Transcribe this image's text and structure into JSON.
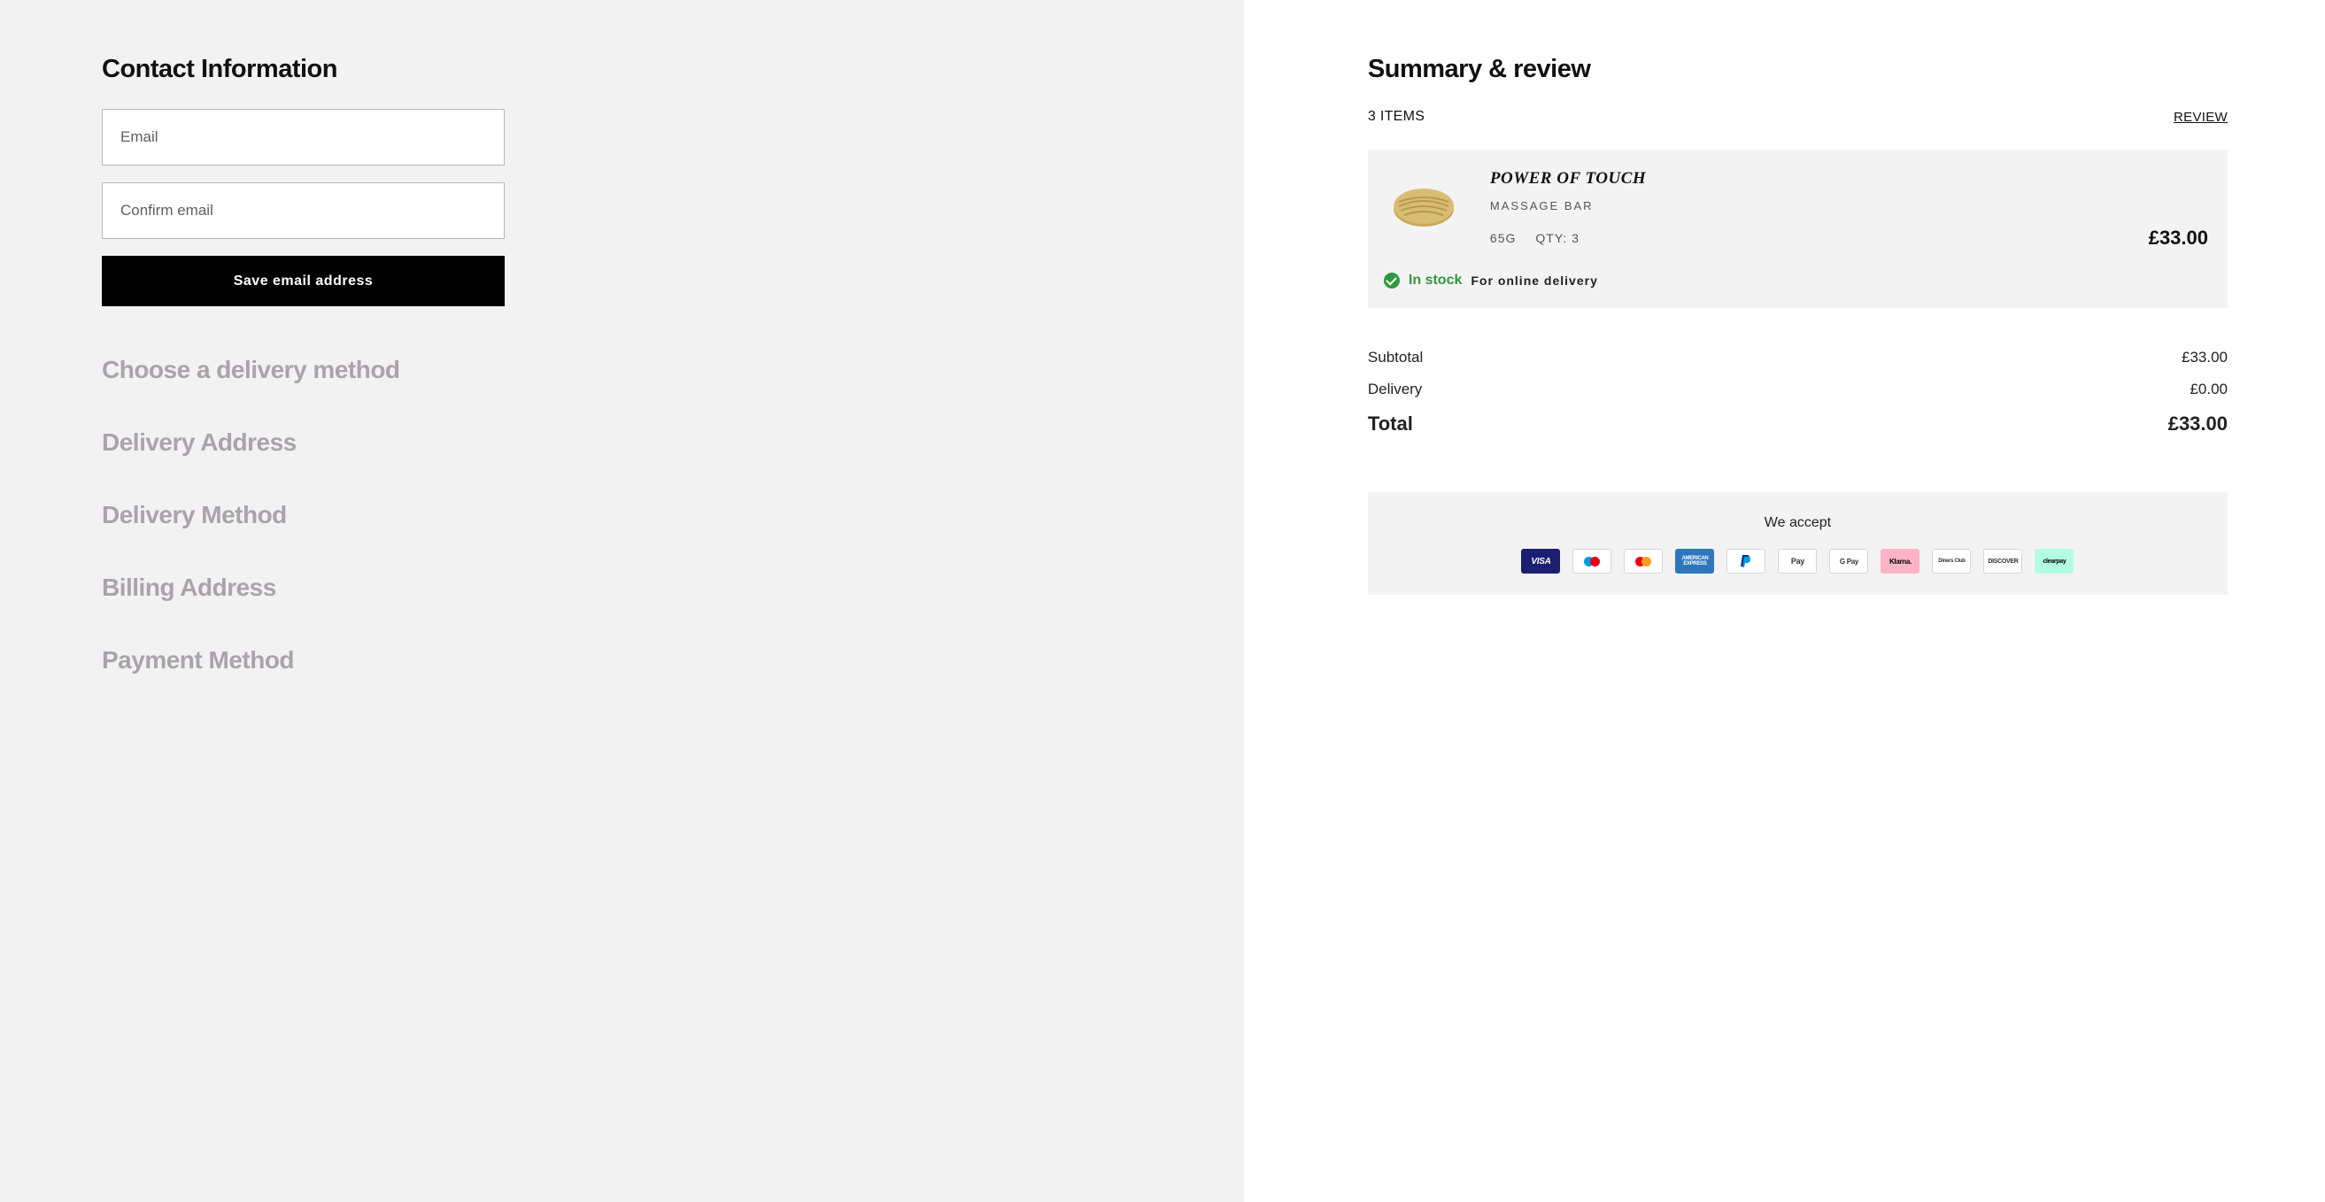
{
  "left": {
    "contact_title": "Contact Information",
    "email_placeholder": "Email",
    "confirm_placeholder": "Confirm email",
    "save_button": "Save email address",
    "steps": [
      "Choose a delivery method",
      "Delivery Address",
      "Delivery Method",
      "Billing Address",
      "Payment Method"
    ]
  },
  "right": {
    "summary_title": "Summary & review",
    "items_label": "3 ITEMS",
    "review_label": "REVIEW",
    "product": {
      "name": "POWER OF TOUCH",
      "subtitle": "MASSAGE BAR",
      "size": "65G",
      "qty_label": "QTY: 3",
      "price": "£33.00",
      "stock_label": "In stock",
      "stock_sub": "For online delivery"
    },
    "totals": {
      "subtotal_label": "Subtotal",
      "subtotal_value": "£33.00",
      "delivery_label": "Delivery",
      "delivery_value": "£0.00",
      "total_label": "Total",
      "total_value": "£33.00"
    },
    "accept_label": "We accept",
    "payments": [
      "visa",
      "maestro",
      "mastercard",
      "amex",
      "paypal",
      "applepay",
      "gpay",
      "klarna",
      "diners",
      "discover",
      "clearpay"
    ]
  }
}
